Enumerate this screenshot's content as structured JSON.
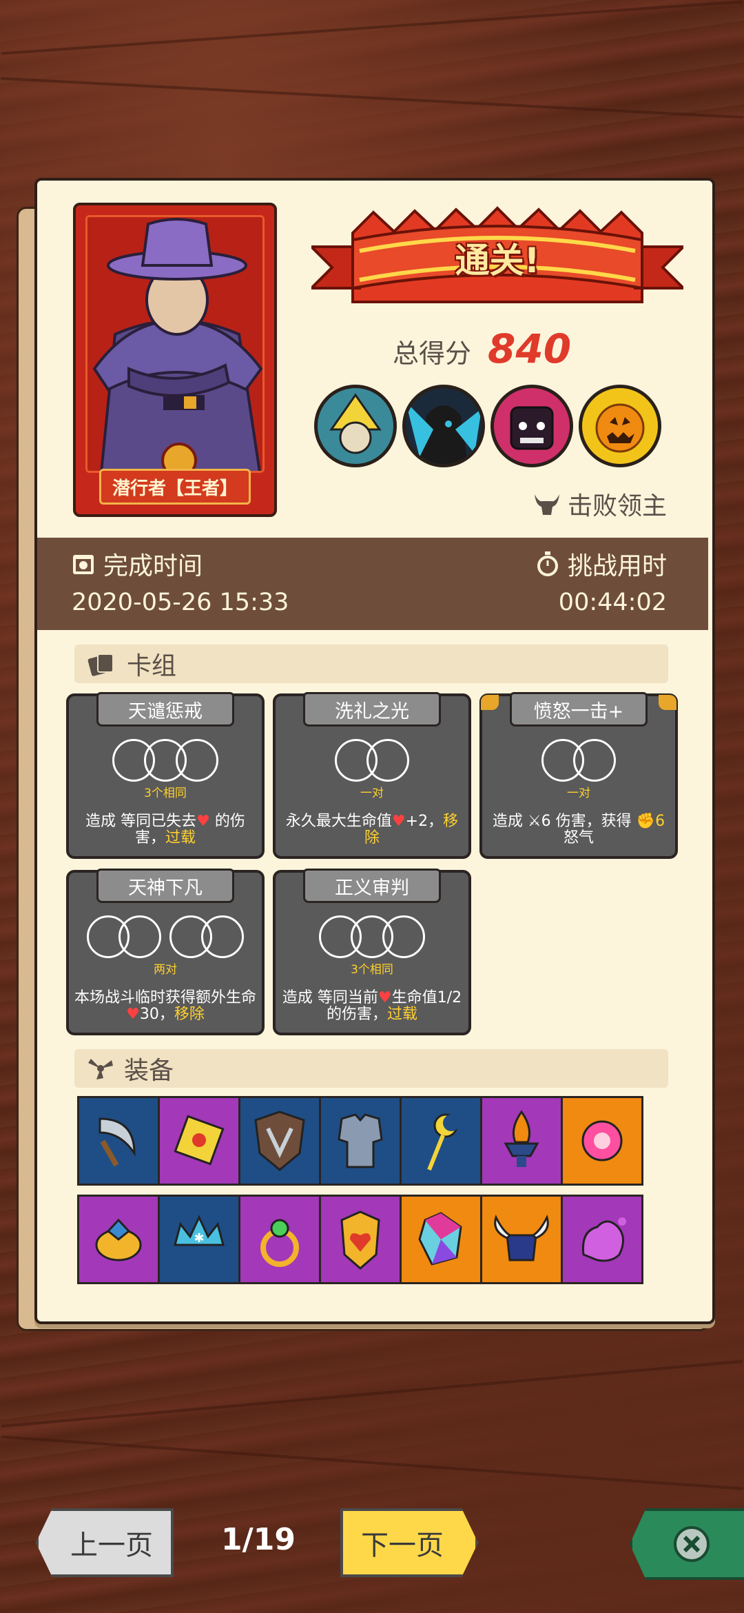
{
  "hero": {
    "name": "潜行者【王者】"
  },
  "banner": {
    "title": "通关!"
  },
  "score": {
    "label": "总得分",
    "value": "840"
  },
  "bosses": [
    "yellow-witch-boss",
    "shadow-boss",
    "demon-boss",
    "pumpkin-boss"
  ],
  "defeat_label": "击败领主",
  "time": {
    "finish_label": "完成时间",
    "finish_value": "2020-05-26 15:33",
    "duration_label": "挑战用时",
    "duration_value": "00:44:02"
  },
  "deck": {
    "title": "卡组",
    "cards": [
      {
        "name": "天谴惩戒",
        "req": "3个相同",
        "desc_a": "造成 等同已失去",
        "desc_b": " 的伤害，",
        "desc_c": "过载",
        "circles": 3
      },
      {
        "name": "洗礼之光",
        "req": "一对",
        "desc_a": "永久最大生命值",
        "desc_b": "+2，",
        "desc_c": "移除",
        "circles": 2
      },
      {
        "name": "愤怒一击+",
        "req": "一对",
        "desc_a": "造成 ",
        "desc_b": "6 伤害，获得 ",
        "desc_c": "6",
        "desc_d": "怒气",
        "circles": 2
      },
      {
        "name": "天神下凡",
        "req": "两对",
        "desc_a": "本场战斗临时获得额外生命",
        "desc_b": "30，",
        "desc_c": "移除",
        "circles": 4
      },
      {
        "name": "正义审判",
        "req": "3个相同",
        "desc_a": "造成 等同当前",
        "desc_b": "生命值1/2 的伤害，",
        "desc_c": "过载",
        "circles": 3
      }
    ]
  },
  "equipment": {
    "title": "装备",
    "row1": [
      {
        "icon": "sickle-icon",
        "color": "blue"
      },
      {
        "icon": "rune-icon",
        "color": "purple"
      },
      {
        "icon": "shield-icon",
        "color": "blue"
      },
      {
        "icon": "armor-icon",
        "color": "blue"
      },
      {
        "icon": "moon-staff-icon",
        "color": "blue"
      },
      {
        "icon": "fire-brazier-icon",
        "color": "purple"
      },
      {
        "icon": "fire-orb-icon",
        "color": "orange"
      }
    ],
    "row2": [
      {
        "icon": "gem-ring-icon",
        "color": "purple"
      },
      {
        "icon": "crown-icon",
        "color": "blue"
      },
      {
        "icon": "green-ring-icon",
        "color": "purple"
      },
      {
        "icon": "heart-amulet-icon",
        "color": "purple"
      },
      {
        "icon": "crystal-icon",
        "color": "orange"
      },
      {
        "icon": "horned-helmet-icon",
        "color": "orange"
      },
      {
        "icon": "slime-icon",
        "color": "purple"
      }
    ]
  },
  "nav": {
    "prev": "上一页",
    "page": "1/19",
    "next": "下一页"
  },
  "colors": {
    "accent_red": "#e03a2a",
    "highlight": "#ffd12e",
    "close_green": "#2a8a5a"
  }
}
